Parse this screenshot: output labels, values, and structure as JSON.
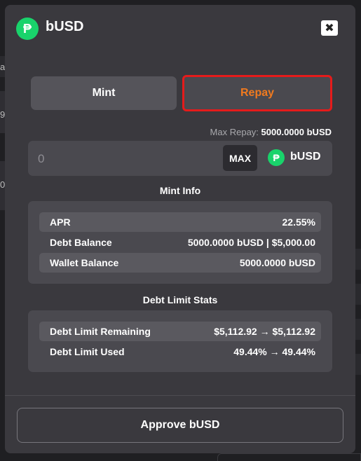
{
  "modal": {
    "title": "bUSD",
    "logo_glyph": "₱",
    "close_glyph": "✖"
  },
  "tabs": [
    {
      "label": "Mint",
      "active": false
    },
    {
      "label": "Repay",
      "active": true
    }
  ],
  "max_repay": {
    "label": "Max Repay:",
    "value": "5000.0000 bUSD"
  },
  "amount_input": {
    "value": "",
    "placeholder": "0",
    "max_label": "MAX",
    "unit_logo_glyph": "₱",
    "unit_label": "bUSD"
  },
  "mint_info": {
    "title": "Mint Info",
    "rows": [
      {
        "label": "APR",
        "value": "22.55%"
      },
      {
        "label": "Debt Balance",
        "value": "5000.0000 bUSD | $5,000.00"
      },
      {
        "label": "Wallet Balance",
        "value": "5000.0000 bUSD"
      }
    ]
  },
  "debt_limit": {
    "title": "Debt Limit Stats",
    "rows": [
      {
        "label": "Debt Limit Remaining",
        "value": "$5,112.92 → $5,112.92"
      },
      {
        "label": "Debt Limit Used",
        "value": "49.44% → 49.44%"
      }
    ]
  },
  "approve_button": {
    "label": "Approve bUSD"
  },
  "background": {
    "peek_texts": [
      "a",
      "9",
      "0"
    ]
  },
  "colors": {
    "accent": "#f07a1f",
    "highlight_border": "#e51b1b",
    "brand": "#19d36b",
    "modal_bg": "#3a393e",
    "panel_bg": "#4a494f"
  },
  "icons": {
    "token": "busd-token-icon",
    "close": "close-icon"
  }
}
